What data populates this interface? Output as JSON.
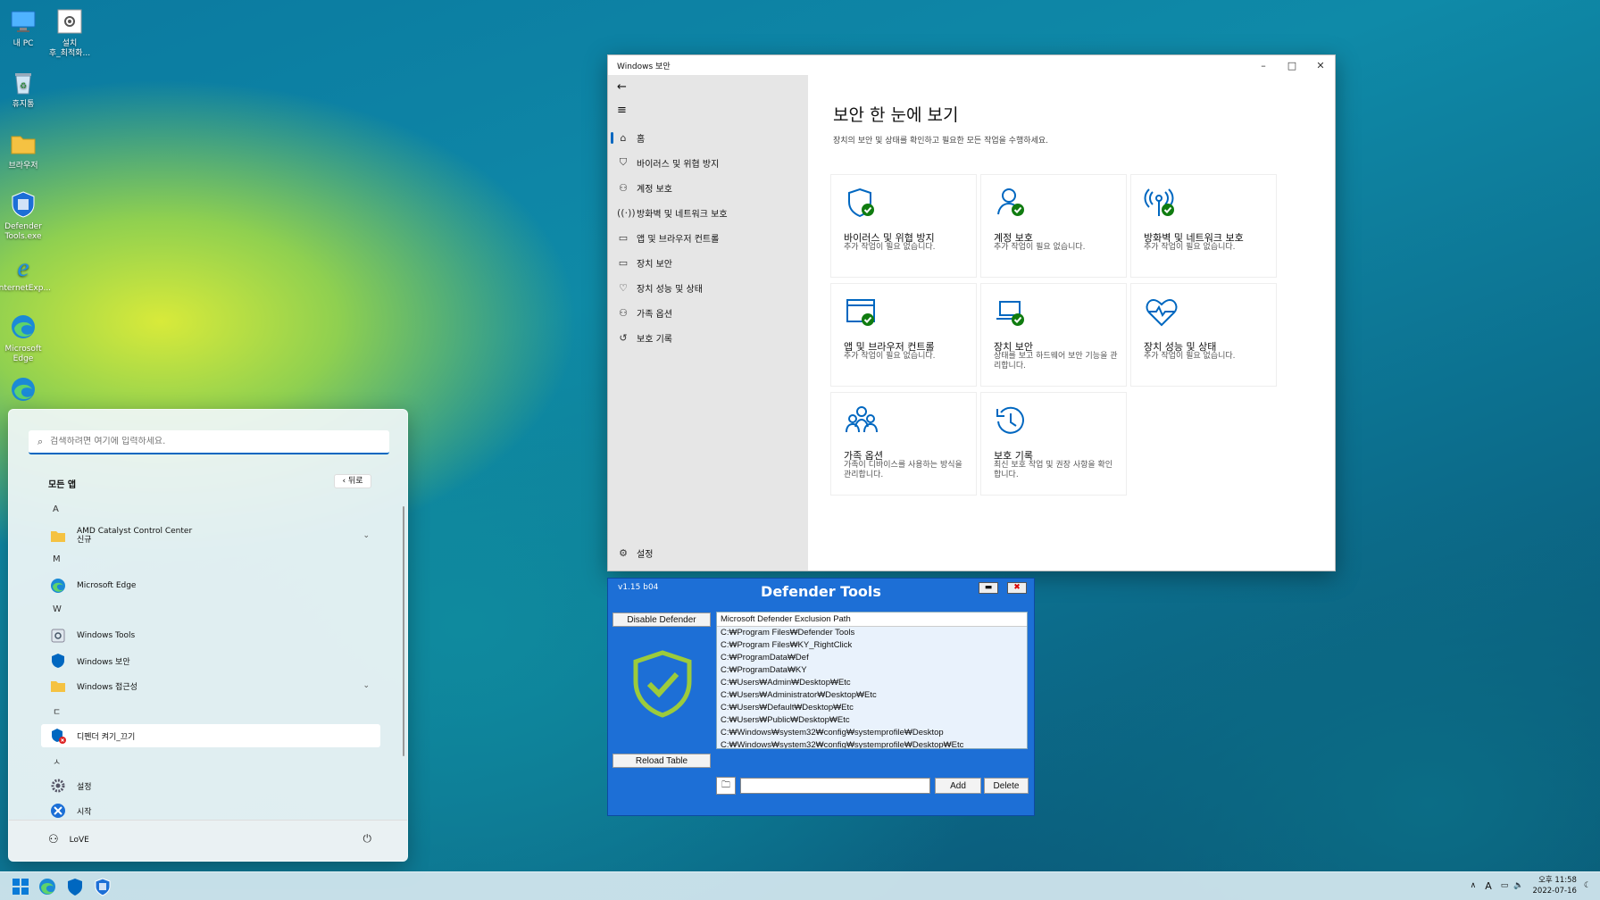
{
  "desktop": {
    "icons": [
      {
        "label": "내 PC",
        "icon": "monitor-icon"
      },
      {
        "label": "설치\n후_최적화...",
        "icon": "settings-file-icon"
      },
      {
        "label": "휴지통",
        "icon": "recycle-bin-icon"
      },
      {
        "label": "브라우저",
        "icon": "folder-icon"
      },
      {
        "label": "Defender\nTools.exe",
        "icon": "defender-tools-icon"
      },
      {
        "label": "InternetExp...",
        "icon": "internet-explorer-icon"
      },
      {
        "label": "Microsoft\nEdge",
        "icon": "edge-icon"
      }
    ]
  },
  "security_window": {
    "title": "Windows 보안",
    "heading": "보안 한 눈에 보기",
    "subheading": "장치의 보안 및 상태를 확인하고 필요한 모든 작업을 수행하세요.",
    "nav": [
      {
        "label": "홈",
        "icon": "home-icon"
      },
      {
        "label": "바이러스 및 위협 방지",
        "icon": "shield-icon"
      },
      {
        "label": "계정 보호",
        "icon": "person-icon"
      },
      {
        "label": "방화벽 및 네트워크 보호",
        "icon": "antenna-icon"
      },
      {
        "label": "앱 및 브라우저 컨트롤",
        "icon": "app-window-icon"
      },
      {
        "label": "장치 보안",
        "icon": "laptop-icon"
      },
      {
        "label": "장치 성능 및 상태",
        "icon": "heart-icon"
      },
      {
        "label": "가족 옵션",
        "icon": "family-icon"
      },
      {
        "label": "보호 기록",
        "icon": "history-icon"
      }
    ],
    "settings_label": "설정",
    "tiles": [
      {
        "title": "바이러스 및 위협 방지",
        "desc": "추가 작업이 필요 없습니다.",
        "icon": "shield-check-icon"
      },
      {
        "title": "계정 보호",
        "desc": "추가 작업이 필요 없습니다.",
        "icon": "person-check-icon"
      },
      {
        "title": "방화벽 및 네트워크 보호",
        "desc": "추가 작업이 필요 없습니다.",
        "icon": "antenna-check-icon"
      },
      {
        "title": "앱 및 브라우저 컨트롤",
        "desc": "추가 작업이 필요 없습니다.",
        "icon": "app-window-check-icon"
      },
      {
        "title": "장치 보안",
        "desc": "상태를 보고 하드웨어 보안 기능을 관리합니다.",
        "icon": "laptop-check-icon"
      },
      {
        "title": "장치 성능 및 상태",
        "desc": "추가 작업이 필요 없습니다.",
        "icon": "heart-pulse-icon"
      },
      {
        "title": "가족 옵션",
        "desc": "가족이 디바이스를 사용하는 방식을 관리합니다.",
        "icon": "family-icon"
      },
      {
        "title": "보호 기록",
        "desc": "최신 보호 작업 및 권장 사항을 확인합니다.",
        "icon": "history-icon"
      }
    ]
  },
  "start_menu": {
    "search_placeholder": "검색하려면 여기에 입력하세요.",
    "all_apps": "모든 앱",
    "back": "뒤로",
    "letters": [
      "A",
      "M",
      "W",
      "ㄷ",
      "ㅅ"
    ],
    "apps": [
      {
        "label": "AMD Catalyst Control Center",
        "sub": "신규",
        "icon": "folder-icon"
      },
      {
        "label": "Microsoft Edge",
        "icon": "edge-icon"
      },
      {
        "label": "Windows Tools",
        "icon": "tools-icon"
      },
      {
        "label": "Windows 보안",
        "icon": "shield-icon"
      },
      {
        "label": "Windows 접근성",
        "icon": "folder-icon"
      },
      {
        "label": "디펜더 켜기_끄기",
        "icon": "defender-toggle-icon"
      },
      {
        "label": "설정",
        "icon": "gear-icon"
      },
      {
        "label": "시작",
        "icon": "start-icon"
      }
    ],
    "user": "LoVE"
  },
  "defender_tools": {
    "version": "v1.15 b04",
    "title": "Defender Tools",
    "disable_label": "Disable Defender",
    "reload_label": "Reload Table",
    "list_header": "Microsoft Defender Exclusion Path",
    "paths": [
      "C:₩Program Files₩Defender Tools",
      "C:₩Program Files₩KY_RightClick",
      "C:₩ProgramData₩Def",
      "C:₩ProgramData₩KY",
      "C:₩Users₩Admin₩Desktop₩Etc",
      "C:₩Users₩Administrator₩Desktop₩Etc",
      "C:₩Users₩Default₩Desktop₩Etc",
      "C:₩Users₩Public₩Desktop₩Etc",
      "C:₩Windows₩system32₩config₩systemprofile₩Desktop",
      "C:₩Windows₩system32₩config₩systemprofile₩Desktop₩Etc"
    ],
    "add_label": "Add",
    "delete_label": "Delete",
    "path_value": ""
  },
  "taskbar": {
    "ime": "A",
    "time": "오후 11:58",
    "date": "2022-07-16"
  }
}
